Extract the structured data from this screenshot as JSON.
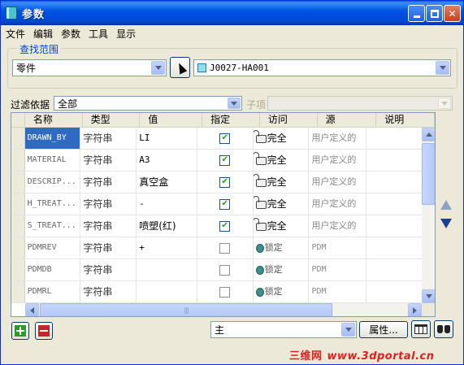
{
  "window": {
    "title": "参数"
  },
  "menu": [
    "文件",
    "编辑",
    "参数",
    "工具",
    "显示"
  ],
  "search_scope": {
    "legend": "查找范围",
    "scope_value": "零件",
    "model_value": "J0027-HA001"
  },
  "filter": {
    "label": "过滤依据",
    "value": "全部",
    "sub_label": "子项",
    "sub_value": ""
  },
  "table": {
    "headers": [
      "名称",
      "类型",
      "值",
      "指定",
      "访问",
      "源",
      "说明"
    ],
    "rows": [
      {
        "name": "DRAWN_BY",
        "type": "字符串",
        "value": "LI",
        "designated": true,
        "access": "完全",
        "source": "用户定义的",
        "desc": ""
      },
      {
        "name": "MATERIAL",
        "type": "字符串",
        "value": "A3",
        "designated": true,
        "access": "完全",
        "source": "用户定义的",
        "desc": ""
      },
      {
        "name": "DESCRIP...",
        "type": "字符串",
        "value": "真空盒",
        "designated": true,
        "access": "完全",
        "source": "用户定义的",
        "desc": ""
      },
      {
        "name": "H_TREAT...",
        "type": "字符串",
        "value": "-",
        "designated": true,
        "access": "完全",
        "source": "用户定义的",
        "desc": ""
      },
      {
        "name": "S_TREAT...",
        "type": "字符串",
        "value": "喷塑(红)",
        "designated": true,
        "access": "完全",
        "source": "用户定义的",
        "desc": ""
      },
      {
        "name": "PDMREV",
        "type": "字符串",
        "value": "+",
        "designated": false,
        "access": "锁定",
        "source": "PDM",
        "desc": ""
      },
      {
        "name": "PDMDB",
        "type": "字符串",
        "value": "",
        "designated": false,
        "access": "锁定",
        "source": "PDM",
        "desc": ""
      },
      {
        "name": "PDMRL",
        "type": "字符串",
        "value": "",
        "designated": false,
        "access": "锁定",
        "source": "PDM",
        "desc": ""
      }
    ]
  },
  "bottom": {
    "main_value": "主",
    "properties_label": "属性..."
  },
  "watermark": {
    "brand": "三维网",
    "url": "www.3dportal.cn"
  },
  "colors": {
    "selection": "#316ac5",
    "title_bar": "#0055e5",
    "add_green": "#2c9b2c",
    "remove_red": "#c3272b"
  }
}
